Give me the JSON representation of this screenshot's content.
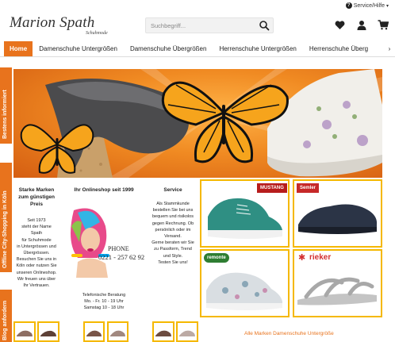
{
  "header": {
    "service_label": "Service/Hilfe",
    "logo_main": "Marion Spath",
    "logo_sub": "Schuhmode",
    "search_placeholder": "Suchbegriff...",
    "icons": [
      "heart-icon",
      "user-icon",
      "cart-icon"
    ]
  },
  "nav": {
    "items": [
      "Home",
      "Damenschuhe Untergrößen",
      "Damenschuhe Übergrößen",
      "Herrenschuhe Untergrößen",
      "Herrenschuhe Überg"
    ]
  },
  "side_tabs": [
    "Bestens informiert",
    "Offline City-Shopping in Köln",
    "Blog anfordern"
  ],
  "info": {
    "col1": {
      "title": "Starke Marken zum günstigen Preis",
      "lines": [
        "Seit 1973",
        "steht der Name",
        "Spath",
        "für Schuhmode",
        "in Untergrössen und",
        "Übergrössen.",
        "Besuchen Sie uns in",
        "Köln oder nutzen Sie",
        "unseren Onlineshop.",
        "Wir freuen uns über",
        "Ihr Vertrauen."
      ]
    },
    "col2": {
      "title": "Ihr Onlineshop seit 1999",
      "phone_label": "PHONE",
      "phone_number": "0221 - 257 62 92",
      "hours_title": "Telefonische Beratung",
      "hours_weekday": "Mo. - Fr. 10 - 19 Uhr",
      "hours_saturday": "Samstag 10 - 18 Uhr"
    },
    "col3": {
      "title": "Service",
      "lines": [
        "Als Stammkunde",
        "bestellen Sie bei uns",
        "bequem und risikolos",
        "gegen Rechnung. Ob",
        "persönlich oder im",
        "Versand.",
        "Gerne beraten wir Sie",
        "zu Passform, Trend",
        "und Style.",
        "Testen Sie uns!"
      ]
    }
  },
  "brands": [
    "MUSTANG",
    "Semler",
    "remonte",
    "rieker"
  ],
  "bottom": {
    "text": "Alle Marken Damenschuhe Untergröße"
  },
  "colors": {
    "accent": "#e8731d",
    "card_border": "#f5b800"
  }
}
